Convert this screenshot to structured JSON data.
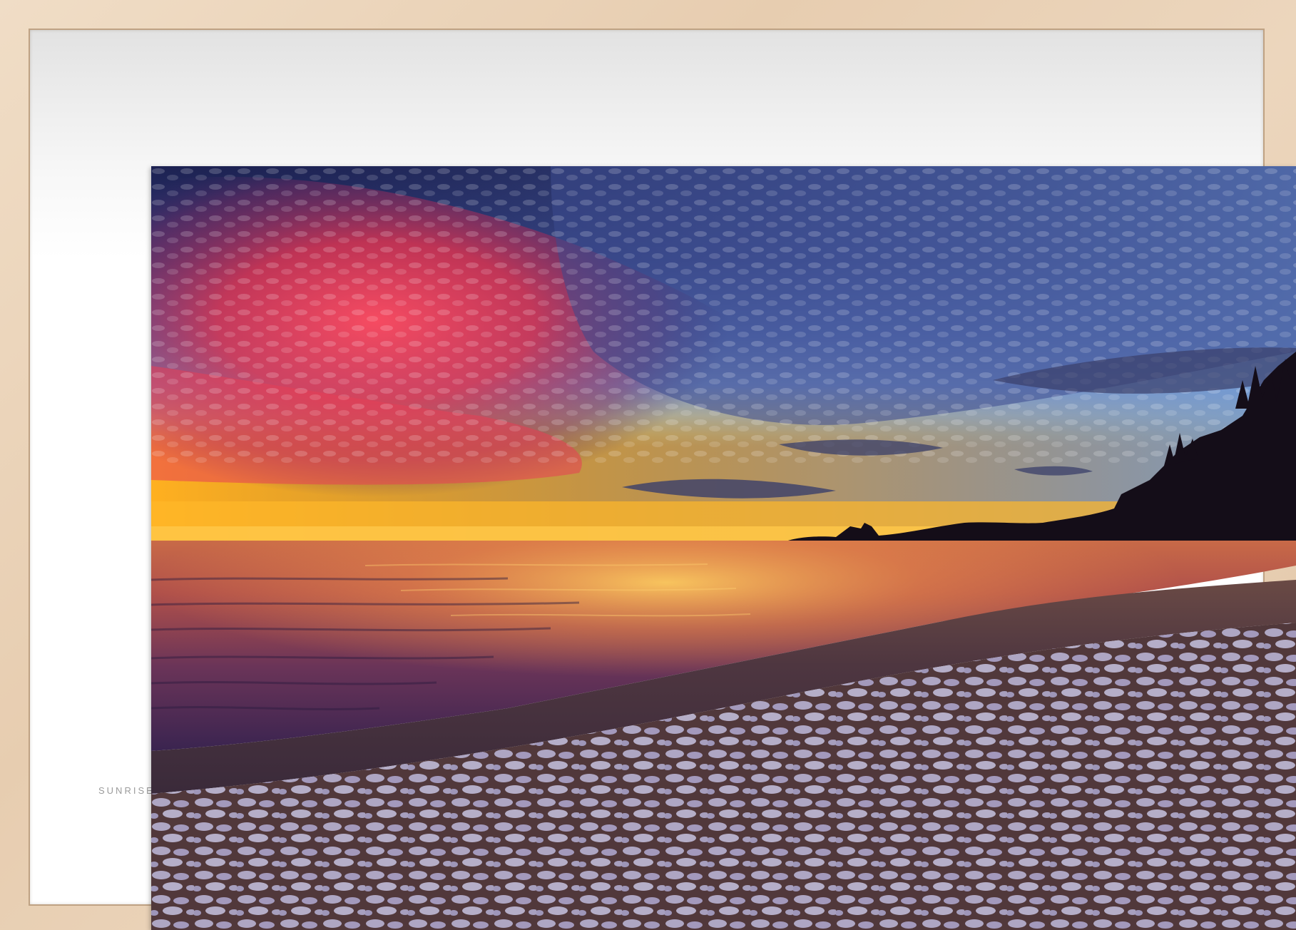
{
  "frame": {
    "wood_color": "#e8cfb2",
    "mat_color": "#ffffff"
  },
  "mat": {
    "caption": "SUNRISE"
  },
  "photo": {
    "subject": "sunset-over-snowy-beach",
    "colors": {
      "sky_dark": "#1f2456",
      "sky_mid": "#3a4a8c",
      "sky_blue": "#7da2d6",
      "cloud_red": "#e8405a",
      "horizon_gold": "#ffc23a",
      "water_purple": "#4a2a55",
      "sand": "#5a3e35",
      "snow": "#c9c3e0"
    }
  }
}
